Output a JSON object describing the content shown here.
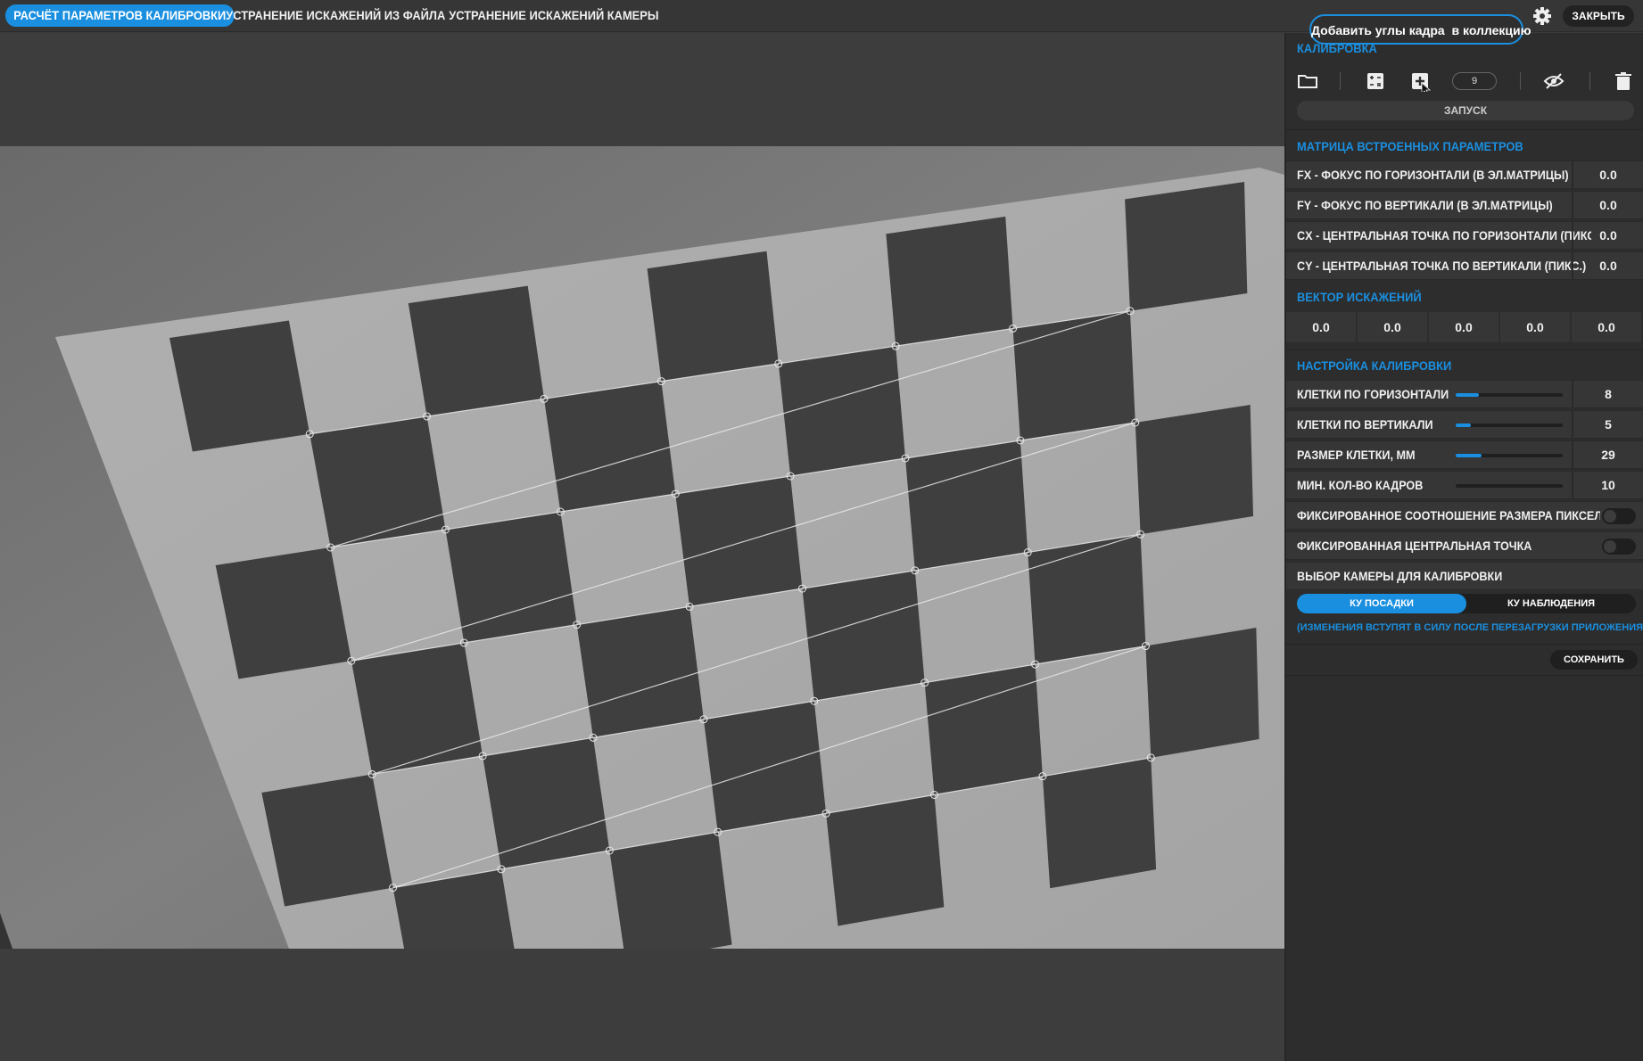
{
  "tabs": [
    {
      "label": "РАСЧЁТ ПАРАМЕТРОВ КАЛИБРОВКИ",
      "active": true
    },
    {
      "label": "УСТРАНЕНИЕ ИСКАЖЕНИЙ ИЗ ФАЙЛА",
      "active": false
    },
    {
      "label": "УСТРАНЕНИЕ ИСКАЖЕНИЙ КАМЕРЫ",
      "active": false
    }
  ],
  "header": {
    "settings_icon": "gear-icon",
    "close_label": "ЗАКРЫТЬ"
  },
  "tooltip": {
    "text": "Добавить углы кадра  в коллекцию"
  },
  "calibration": {
    "title": "КАЛИБРОВКА",
    "toolbar_icons": [
      "folder-icon",
      "calculator-icon",
      "add-frame-icon",
      "eye-off-icon",
      "trash-icon"
    ],
    "frame_count": "9",
    "run_label": "ЗАПУСК"
  },
  "matrix": {
    "title": "МАТРИЦА ВСТРОЕННЫХ ПАРАМЕТРОВ",
    "rows": [
      {
        "label": "FX - ФОКУС ПО ГОРИЗОНТАЛИ (В ЭЛ.МАТРИЦЫ)",
        "value": "0.0"
      },
      {
        "label": "FY - ФОКУС ПО ВЕРТИКАЛИ (В ЭЛ.МАТРИЦЫ)",
        "value": "0.0"
      },
      {
        "label": "CX - ЦЕНТРАЛЬНАЯ ТОЧКА ПО ГОРИЗОНТАЛИ (ПИКС",
        "value": "0.0"
      },
      {
        "label": "CY - ЦЕНТРАЛЬНАЯ ТОЧКА ПО ВЕРТИКАЛИ (ПИКС.)",
        "value": "0.0"
      }
    ]
  },
  "distortion": {
    "title": "ВЕКТОР ИСКАЖЕНИЙ",
    "values": [
      "0.0",
      "0.0",
      "0.0",
      "0.0",
      "0.0"
    ]
  },
  "settings": {
    "title": "НАСТРОЙКА КАЛИБРОВКИ",
    "sliders": [
      {
        "label": "КЛЕТКИ ПО ГОРИЗОНТАЛИ",
        "value": "8",
        "level": 0.22
      },
      {
        "label": "КЛЕТКИ ПО ВЕРТИКАЛИ",
        "value": "5",
        "level": 0.14
      },
      {
        "label": "РАЗМЕР КЛЕТКИ, ММ",
        "value": "29",
        "level": 0.24
      },
      {
        "label": "МИН. КОЛ-ВО КАДРОВ",
        "value": "10",
        "level": 0.0
      }
    ],
    "toggles": [
      {
        "label": "ФИКСИРОВАННОЕ СООТНОШЕНИЕ РАЗМЕРА ПИКСЕЛЯ",
        "on": false
      },
      {
        "label": "ФИКСИРОВАННАЯ ЦЕНТРАЛЬНАЯ ТОЧКА",
        "on": false
      }
    ],
    "camera_title": "ВЫБОР КАМЕРЫ ДЛЯ КАЛИБРОВКИ",
    "camera_options": [
      "КУ ПОСАДКИ",
      "КУ НАБЛЮДЕНИЯ"
    ],
    "camera_selected": "КУ ПОСАДКИ",
    "note": "(ИЗМЕНЕНИЯ ВСТУПЯТ В СИЛУ ПОСЛЕ ПЕРЕЗАГРУЗКИ ПРИЛОЖЕНИЯ)",
    "save_label": "СОХРАНИТЬ"
  },
  "colors": {
    "accent": "#1a8fe0",
    "panel": "#2d2d2d",
    "row": "#363636"
  }
}
